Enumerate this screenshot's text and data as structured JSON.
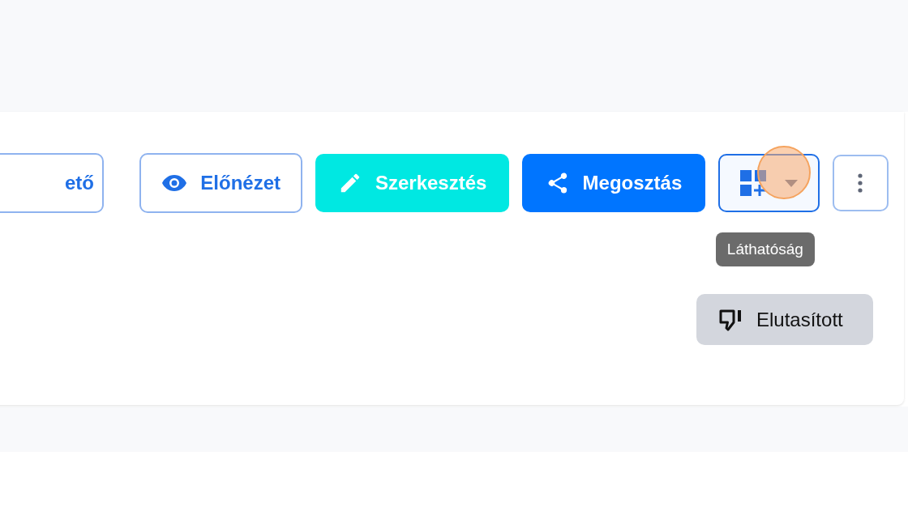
{
  "toolbar": {
    "buttons": [
      {
        "kind": "outline",
        "label": "ető"
      },
      {
        "kind": "preview",
        "label": "Előnézet"
      },
      {
        "kind": "cyan",
        "label": "Szerkesztés"
      },
      {
        "kind": "primary",
        "label": "Megosztás"
      },
      {
        "kind": "visibility",
        "tooltip": "Láthatóság",
        "click_highlight": true
      },
      {
        "kind": "more"
      }
    ]
  },
  "status": {
    "label": "Elutasított"
  }
}
